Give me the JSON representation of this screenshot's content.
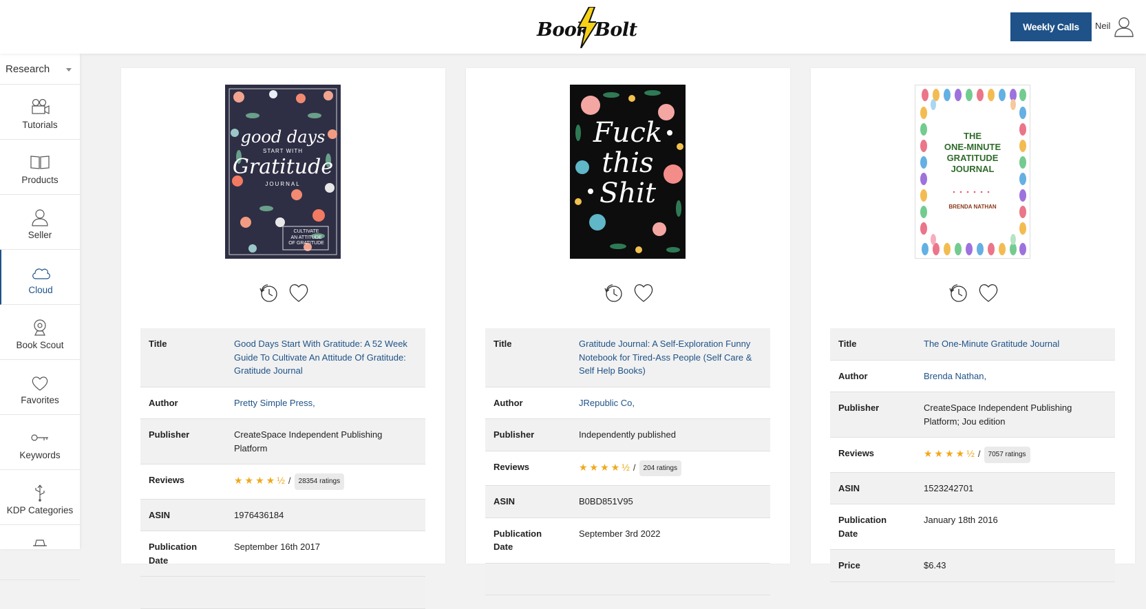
{
  "header": {
    "logo_left": "Book",
    "logo_right": "Bolt",
    "weekly_calls_label": "Weekly Calls",
    "user_name": "Neil"
  },
  "sidebar": {
    "select_label": "Research",
    "items": [
      {
        "label": "Tutorials",
        "icon": "video-camera-icon"
      },
      {
        "label": "Products",
        "icon": "book-icon"
      },
      {
        "label": "Seller",
        "icon": "user-icon"
      },
      {
        "label": "Cloud",
        "icon": "cloud-icon",
        "active": true
      },
      {
        "label": "Book Scout",
        "icon": "webcam-icon"
      },
      {
        "label": "Favorites",
        "icon": "heart-icon"
      },
      {
        "label": "Keywords",
        "icon": "key-icon"
      },
      {
        "label": "KDP Categories",
        "icon": "usb-icon"
      }
    ]
  },
  "labels": {
    "title": "Title",
    "author": "Author",
    "publisher": "Publisher",
    "reviews": "Reviews",
    "asin": "ASIN",
    "publication_date": "Publication Date",
    "price": "Price",
    "slash": "/"
  },
  "colors": {
    "accent": "#1e5288",
    "star": "#f0a81c"
  },
  "books": [
    {
      "title": "Good Days Start With Gratitude: A 52 Week Guide To Cultivate An Attitude Of Gratitude: Gratitude Journal",
      "author": "Pretty Simple Press,",
      "publisher": "CreateSpace Independent Publishing Platform",
      "stars": "★★★★½",
      "rating_count": "28354 ratings",
      "asin": "1976436184",
      "publication_date": "September 16th 2017",
      "cover": {
        "top": "good days",
        "mid": "START WITH",
        "main": "Gratitude",
        "sub": "JOURNAL",
        "box": "CULTIVATE\nAN ATTITUDE\nOF GRATITUDE",
        "bg": "#2e2f45"
      }
    },
    {
      "title": "Gratitude Journal: A Self-Exploration Funny Notebook for Tired-Ass People (Self Care & Self Help Books)",
      "author": "JRepublic Co,",
      "publisher": "Independently published",
      "stars": "★★★★½",
      "rating_count": "204 ratings",
      "asin": "B0BD851V95",
      "publication_date": "September 3rd 2022",
      "cover": {
        "main": "Fuck\nthis\nShit",
        "bg": "#0d0d0d"
      }
    },
    {
      "title": "The One-Minute Gratitude Journal",
      "author": "Brenda Nathan,",
      "publisher": "CreateSpace Independent Publishing Platform; Jou edition",
      "stars": "★★★★½",
      "rating_count": "7057 ratings",
      "asin": "1523242701",
      "publication_date": "January 18th 2016",
      "price": "$6.43",
      "cover": {
        "main": "THE\nONE-MINUTE\nGRATITUDE\nJOURNAL",
        "author": "BRENDA NATHAN",
        "bg": "#ffffff"
      }
    }
  ]
}
